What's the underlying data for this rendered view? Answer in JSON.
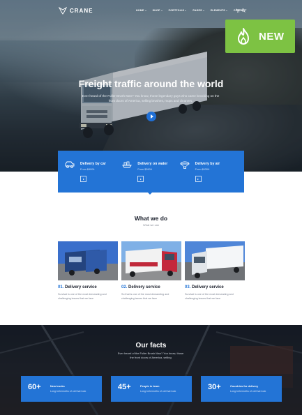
{
  "brand": {
    "name": "CRANE"
  },
  "nav": {
    "items": [
      {
        "label": "HOME",
        "has_dropdown": true
      },
      {
        "label": "SHOP",
        "has_dropdown": true
      },
      {
        "label": "PORTFOLIO",
        "has_dropdown": true
      },
      {
        "label": "PAGES",
        "has_dropdown": true
      },
      {
        "label": "ELEMENTS",
        "has_dropdown": true
      },
      {
        "label": "CONTACT",
        "has_dropdown": false
      }
    ],
    "icons": [
      "cart-icon",
      "search-icon"
    ]
  },
  "badge": {
    "label": "NEW",
    "icon": "flame-icon",
    "color": "#7dc243"
  },
  "hero": {
    "title": "Freight traffic around the world",
    "text": "Ever heard of the Fuller Brush Man? You know, those legendary guys who came knocking on the front doors of America, selling brushes, mops and cleaners.",
    "play_icon": "play-icon"
  },
  "services": [
    {
      "title": "Delivery by car",
      "price": "From $400/t",
      "icon": "car-icon"
    },
    {
      "title": "Delivery on water",
      "price": "From $260/t",
      "icon": "ship-icon"
    },
    {
      "title": "Delivery by air",
      "price": "From $430/t",
      "icon": "parachute-icon"
    }
  ],
  "what_we_do": {
    "title": "What we do",
    "subtitle": "What we can",
    "cards": [
      {
        "number": "01.",
        "title": "Delivery service",
        "text": "Survival is one of the most demanding and challenging issues that we face",
        "photo": "blue-truck-photo"
      },
      {
        "number": "02.",
        "title": "Delivery service",
        "text": "So that is one of the most demanding and challenging issues that we face",
        "photo": "red-truck-photo"
      },
      {
        "number": "03.",
        "title": "Delivery service",
        "text": "Survival is one of the most demanding and challenging issues that we face",
        "photo": "white-truck-photo"
      }
    ]
  },
  "facts": {
    "title": "Our facts",
    "text": "Ever heard of the Fuller Brush Man? You know, those the front doors of America, selling",
    "items": [
      {
        "number": "60+",
        "label": "New trucks",
        "sub": "Long behemoths of old that took"
      },
      {
        "number": "45+",
        "label": "People in team",
        "sub": "Long behemoths of old that took"
      },
      {
        "number": "30+",
        "label": "Countries for delivery",
        "sub": "Long behemoths of old that took"
      }
    ]
  },
  "colors": {
    "accent": "#2374d6",
    "badge": "#7dc243",
    "dark": "#1b2330"
  }
}
